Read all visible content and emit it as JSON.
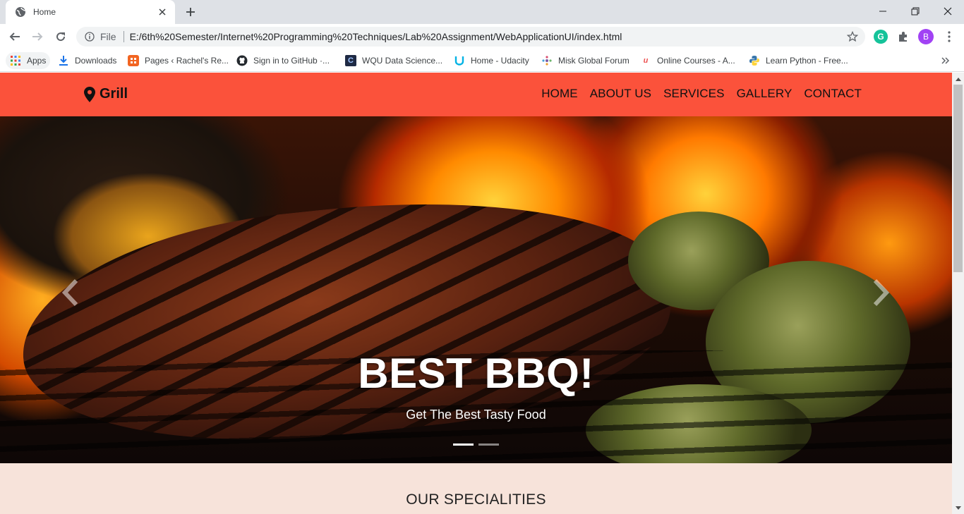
{
  "browser": {
    "tab_title": "Home",
    "omnibox": {
      "scheme": "File",
      "url": "E:/6th%20Semester/Internet%20Programming%20Techniques/Lab%20Assignment/WebApplicationUI/index.html"
    },
    "profile_initial": "B",
    "bookmarks": [
      {
        "label": "Apps",
        "icon": "apps-grid-icon"
      },
      {
        "label": "Downloads",
        "icon": "download-icon"
      },
      {
        "label": "Pages ‹ Rachel's Re...",
        "icon": "pages-icon"
      },
      {
        "label": "Sign in to GitHub ·...",
        "icon": "github-icon"
      },
      {
        "label": "WQU Data Science...",
        "icon": "wqu-icon"
      },
      {
        "label": "Home - Udacity",
        "icon": "udacity-icon"
      },
      {
        "label": "Misk Global Forum",
        "icon": "misk-icon"
      },
      {
        "label": "Online Courses - A...",
        "icon": "udemy-icon"
      },
      {
        "label": "Learn Python - Free...",
        "icon": "python-icon"
      }
    ]
  },
  "site": {
    "brand": "Grill",
    "menu": [
      "HOME",
      "ABOUT US",
      "SERVICES",
      "GALLERY",
      "CONTACT"
    ],
    "hero": {
      "title": "BEST BBQ!",
      "subtitle": "Get The Best Tasty Food",
      "slide_count": 2,
      "active_slide": 1
    },
    "specialities_title": "OUR SPECIALITIES"
  },
  "colors": {
    "nav_bg": "#fb523b",
    "specialities_bg": "#f7e3da",
    "chrome_bg": "#dee1e6"
  }
}
